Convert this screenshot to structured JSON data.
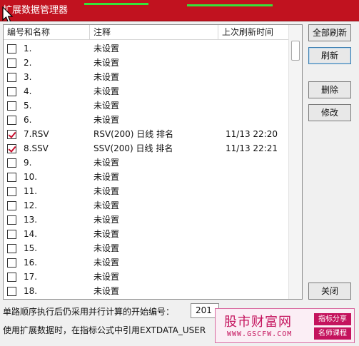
{
  "window": {
    "title": "扩展数据管理器"
  },
  "list": {
    "columns": [
      "编号和名称",
      "注释",
      "上次刷新时间"
    ],
    "rows": [
      {
        "name": "1.",
        "note": "未设置",
        "time": "",
        "checked": false
      },
      {
        "name": "2.",
        "note": "未设置",
        "time": "",
        "checked": false
      },
      {
        "name": "3.",
        "note": "未设置",
        "time": "",
        "checked": false
      },
      {
        "name": "4.",
        "note": "未设置",
        "time": "",
        "checked": false
      },
      {
        "name": "5.",
        "note": "未设置",
        "time": "",
        "checked": false
      },
      {
        "name": "6.",
        "note": "未设置",
        "time": "",
        "checked": false
      },
      {
        "name": "7.RSV",
        "note": "RSV(200) 日线 排名",
        "time": "11/13 22:20",
        "checked": true
      },
      {
        "name": "8.SSV",
        "note": "SSV(200) 日线 排名",
        "time": "11/13 22:21",
        "checked": true
      },
      {
        "name": "9.",
        "note": "未设置",
        "time": "",
        "checked": false
      },
      {
        "name": "10.",
        "note": "未设置",
        "time": "",
        "checked": false
      },
      {
        "name": "11.",
        "note": "未设置",
        "time": "",
        "checked": false
      },
      {
        "name": "12.",
        "note": "未设置",
        "time": "",
        "checked": false
      },
      {
        "name": "13.",
        "note": "未设置",
        "time": "",
        "checked": false
      },
      {
        "name": "14.",
        "note": "未设置",
        "time": "",
        "checked": false
      },
      {
        "name": "15.",
        "note": "未设置",
        "time": "",
        "checked": false
      },
      {
        "name": "16.",
        "note": "未设置",
        "time": "",
        "checked": false
      },
      {
        "name": "17.",
        "note": "未设置",
        "time": "",
        "checked": false
      },
      {
        "name": "18.",
        "note": "未设置",
        "time": "",
        "checked": false
      }
    ]
  },
  "buttons": {
    "refresh_all": "全部刷新",
    "refresh": "刷新",
    "delete": "删除",
    "modify": "修改",
    "close": "关闭"
  },
  "footer": {
    "start_label": "单路顺序执行后仍采用并行计算的开始编号：",
    "start_value": "201",
    "usage_text": "使用扩展数据时，在指标公式中引用EXTDATA_USER"
  },
  "watermark": {
    "title": "股市财富网",
    "url": "WWW.GSCFW.COM",
    "tag1": "指标分享",
    "tag2": "名师课程"
  },
  "colors": {
    "titlebar": "#c1121f",
    "checkmark": "#c8102e",
    "watermark": "#c4135d"
  }
}
